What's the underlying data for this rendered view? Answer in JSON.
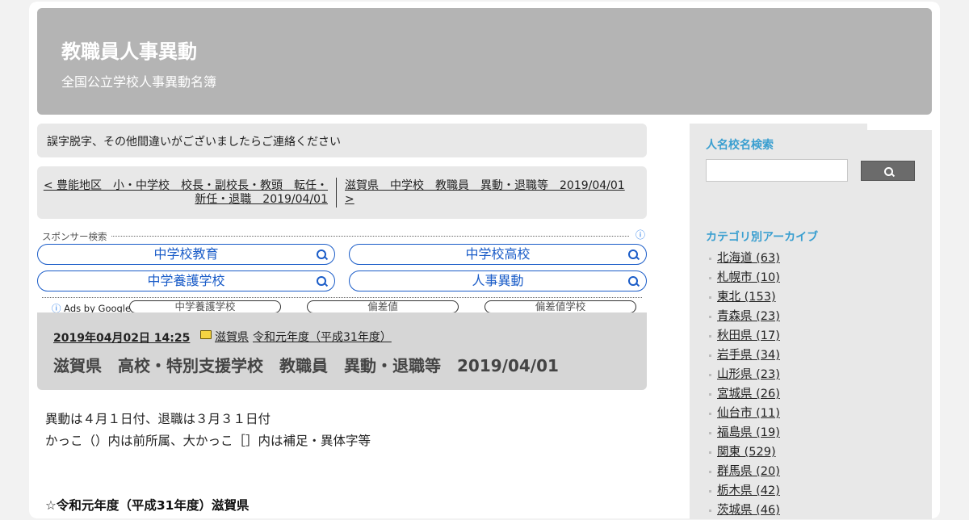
{
  "header": {
    "title": "教職員人事異動",
    "subtitle": "全国公立学校人事異動名簿"
  },
  "notice": "誤字脱字、その他間違いがございましたらご連絡ください",
  "pager": {
    "prev_line1": "< 豊能地区　小・中学校　校長・副校長・教頭　転任・",
    "prev_line2": "新任・退職　2019/04/01",
    "next_line1": "滋賀県　中学校　教職員　異動・退職等　2019/04/01",
    "next_line2": ">"
  },
  "ads": {
    "label": "スポンサー検索",
    "info_icon": "ⓘ",
    "buttons": [
      "中学校教育",
      "中学校高校",
      "中学養護学校",
      "人事異動"
    ],
    "ads_by": "Ads by Google",
    "related": [
      "中学養護学校",
      "偏差値",
      "偏差値学校"
    ]
  },
  "post": {
    "date": "2019年04月02日 14:25",
    "categories": [
      "滋賀県",
      "令和元年度（平成31年度）"
    ],
    "title": "滋賀県　高校・特別支援学校　教職員　異動・退職等　2019/04/01",
    "body": [
      "異動は４月１日付、退職は３月３１日付",
      "かっこ（）内は前所属、大かっこ［］内は補足・異体字等"
    ],
    "section": "☆令和元年度（平成31年度）滋賀県"
  },
  "sidebar": {
    "search_title": "人名校名検索",
    "search_placeholder": "",
    "archive_title": "カテゴリ別アーカイブ",
    "categories": [
      "北海道 (63)",
      "札幌市 (10)",
      "東北 (153)",
      "青森県 (23)",
      "秋田県 (17)",
      "岩手県 (34)",
      "山形県 (23)",
      "宮城県 (26)",
      "仙台市 (11)",
      "福島県 (19)",
      "関東 (529)",
      "群馬県 (20)",
      "栃木県 (42)",
      "茨城県 (46)"
    ]
  }
}
